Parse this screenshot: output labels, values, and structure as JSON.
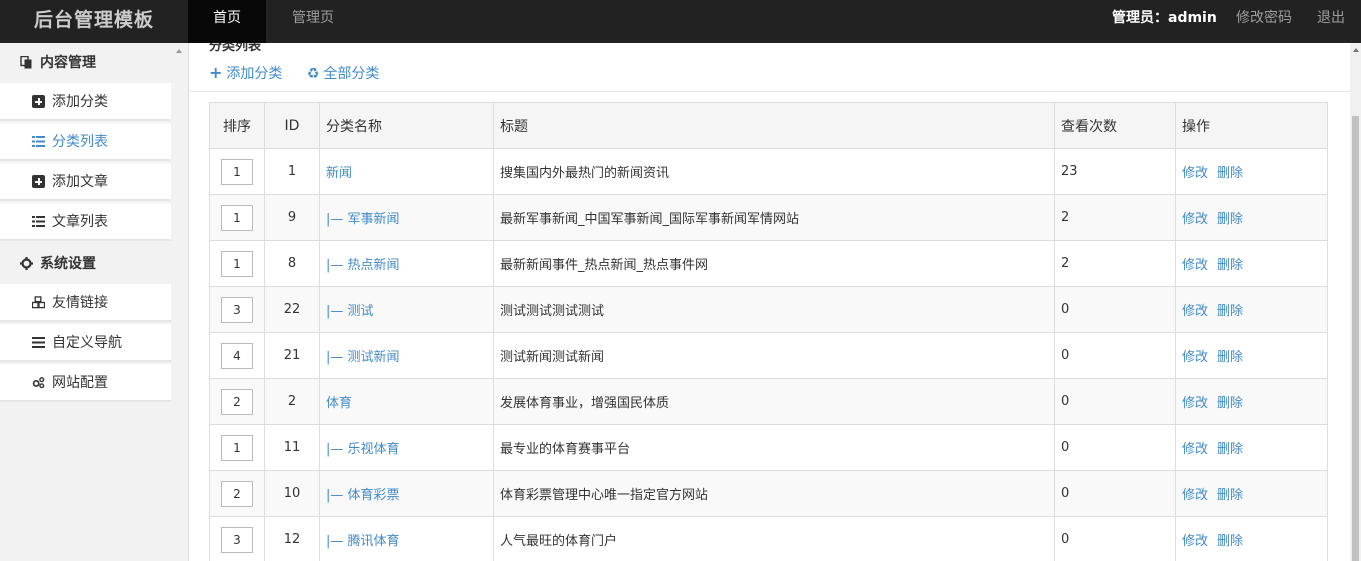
{
  "brand": "后台管理模板",
  "top_nav": {
    "tabs": [
      "首页",
      "管理页"
    ],
    "active": "首页"
  },
  "top_right": {
    "admin": "管理员：admin",
    "change_password": "修改密码",
    "logout": "退出"
  },
  "sidebar": {
    "sections": [
      {
        "title": "内容管理",
        "icon": "copy-icon",
        "items": [
          {
            "label": "添加分类",
            "icon": "plus-square-icon"
          },
          {
            "label": "分类列表",
            "icon": "list-icon",
            "active": true
          },
          {
            "label": "添加文章",
            "icon": "plus-square-icon"
          },
          {
            "label": "文章列表",
            "icon": "list-icon"
          }
        ]
      },
      {
        "title": "系统设置",
        "icon": "gear-icon",
        "items": [
          {
            "label": "友情链接",
            "icon": "cubes-icon"
          },
          {
            "label": "自定义导航",
            "icon": "bars-icon"
          },
          {
            "label": "网站配置",
            "icon": "gears-icon"
          }
        ]
      }
    ]
  },
  "main": {
    "section_title": "分类列表",
    "toolbar": {
      "add": "添加分类",
      "all": "全部分类"
    },
    "table": {
      "headers": [
        "排序",
        "ID",
        "分类名称",
        "标题",
        "查看次数",
        "操作"
      ],
      "rows": [
        {
          "order": "1",
          "id": "1",
          "name": "新闻",
          "title": "搜集国内外最热门的新闻资讯",
          "views": "23"
        },
        {
          "order": "1",
          "id": "9",
          "name": "|— 军事新闻",
          "title": "最新军事新闻_中国军事新闻_国际军事新闻军情网站",
          "views": "2"
        },
        {
          "order": "1",
          "id": "8",
          "name": "|— 热点新闻",
          "title": "最新新闻事件_热点新闻_热点事件网",
          "views": "2"
        },
        {
          "order": "3",
          "id": "22",
          "name": "|— 测试",
          "title": "测试测试测试测试",
          "views": "0"
        },
        {
          "order": "4",
          "id": "21",
          "name": "|— 测试新闻",
          "title": "测试新闻测试新闻",
          "views": "0"
        },
        {
          "order": "2",
          "id": "2",
          "name": "体育",
          "title": "发展体育事业，增强国民体质",
          "views": "0"
        },
        {
          "order": "1",
          "id": "11",
          "name": "|— 乐视体育",
          "title": "最专业的体育赛事平台",
          "views": "0"
        },
        {
          "order": "2",
          "id": "10",
          "name": "|— 体育彩票",
          "title": "体育彩票管理中心唯一指定官方网站",
          "views": "0"
        },
        {
          "order": "3",
          "id": "12",
          "name": "|— 腾讯体育",
          "title": "人气最旺的体育门户",
          "views": "0"
        }
      ],
      "actions": {
        "edit": "修改",
        "delete": "删除"
      }
    }
  },
  "colors": {
    "link": "#428bca",
    "topbar": "#222222",
    "sidebar_bg": "#f2f2f2"
  }
}
